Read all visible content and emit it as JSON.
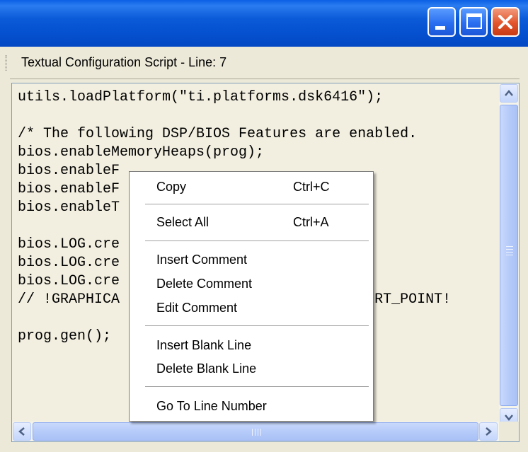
{
  "window": {
    "title": "",
    "controls": [
      "minimize",
      "maximize",
      "close"
    ]
  },
  "editor": {
    "header": "Textual Configuration Script - Line: 7",
    "lines": [
      "utils.loadPlatform(\"ti.platforms.dsk6416\");",
      "",
      "/* The following DSP/BIOS Features are enabled.",
      "bios.enableMemoryHeaps(prog);",
      "bios.enableF",
      "bios.enableF",
      "bios.enableT",
      "",
      "bios.LOG.cre",
      "bios.LOG.cre",
      "bios.LOG.cre",
      "// !GRAPHICA                             ERT_POINT!",
      "",
      "prog.gen();"
    ]
  },
  "context_menu": {
    "items": [
      {
        "label": "Copy",
        "shortcut": "Ctrl+C"
      },
      {
        "label": "Select All",
        "shortcut": "Ctrl+A"
      },
      {
        "label": "Insert Comment",
        "shortcut": ""
      },
      {
        "label": "Delete Comment",
        "shortcut": ""
      },
      {
        "label": "Edit Comment",
        "shortcut": ""
      },
      {
        "label": "Insert Blank Line",
        "shortcut": ""
      },
      {
        "label": "Delete Blank Line",
        "shortcut": ""
      },
      {
        "label": "Go To Line Number",
        "shortcut": ""
      }
    ]
  },
  "colors": {
    "titlebar": "#0551d0",
    "editor_bg": "#f2efe0",
    "scrollbar_thumb": "#b6cbf9",
    "close_button": "#e2542b"
  }
}
